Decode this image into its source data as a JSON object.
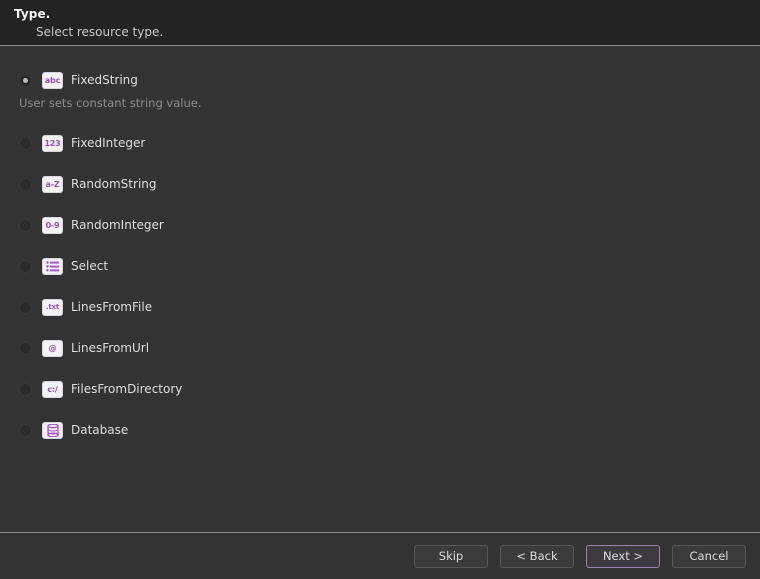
{
  "header": {
    "title": "Type.",
    "subtitle": "Select resource type."
  },
  "options": [
    {
      "label": "FixedString",
      "icon": "abc-icon",
      "icon_text": "abc",
      "icon_kind": "text",
      "selected": true,
      "description": "User sets constant string value."
    },
    {
      "label": "FixedInteger",
      "icon": "123-icon",
      "icon_text": "123",
      "icon_kind": "text",
      "selected": false,
      "description": ""
    },
    {
      "label": "RandomString",
      "icon": "a-z-icon",
      "icon_text": "a-Z",
      "icon_kind": "text",
      "selected": false,
      "description": ""
    },
    {
      "label": "RandomInteger",
      "icon": "0-9-icon",
      "icon_text": "0-9",
      "icon_kind": "text",
      "selected": false,
      "description": ""
    },
    {
      "label": "Select",
      "icon": "list-icon",
      "icon_text": "",
      "icon_kind": "list",
      "selected": false,
      "description": ""
    },
    {
      "label": "LinesFromFile",
      "icon": "txt-file-icon",
      "icon_text": ".txt",
      "icon_kind": "text",
      "selected": false,
      "description": ""
    },
    {
      "label": "LinesFromUrl",
      "icon": "at-sign-icon",
      "icon_text": "@",
      "icon_kind": "text",
      "selected": false,
      "description": ""
    },
    {
      "label": "FilesFromDirectory",
      "icon": "directory-icon",
      "icon_text": "c:/",
      "icon_kind": "text",
      "selected": false,
      "description": ""
    },
    {
      "label": "Database",
      "icon": "database-icon",
      "icon_text": "",
      "icon_kind": "database",
      "selected": false,
      "description": ""
    }
  ],
  "footer": {
    "buttons": [
      {
        "label": "Skip",
        "default": false
      },
      {
        "label": "< Back",
        "default": false
      },
      {
        "label": "Next >",
        "default": true
      },
      {
        "label": "Cancel",
        "default": false
      }
    ]
  },
  "colors": {
    "accent": "#9d4fc4",
    "default_button_border": "#9b7fb0",
    "background": "#333333",
    "header_background": "#232323"
  }
}
